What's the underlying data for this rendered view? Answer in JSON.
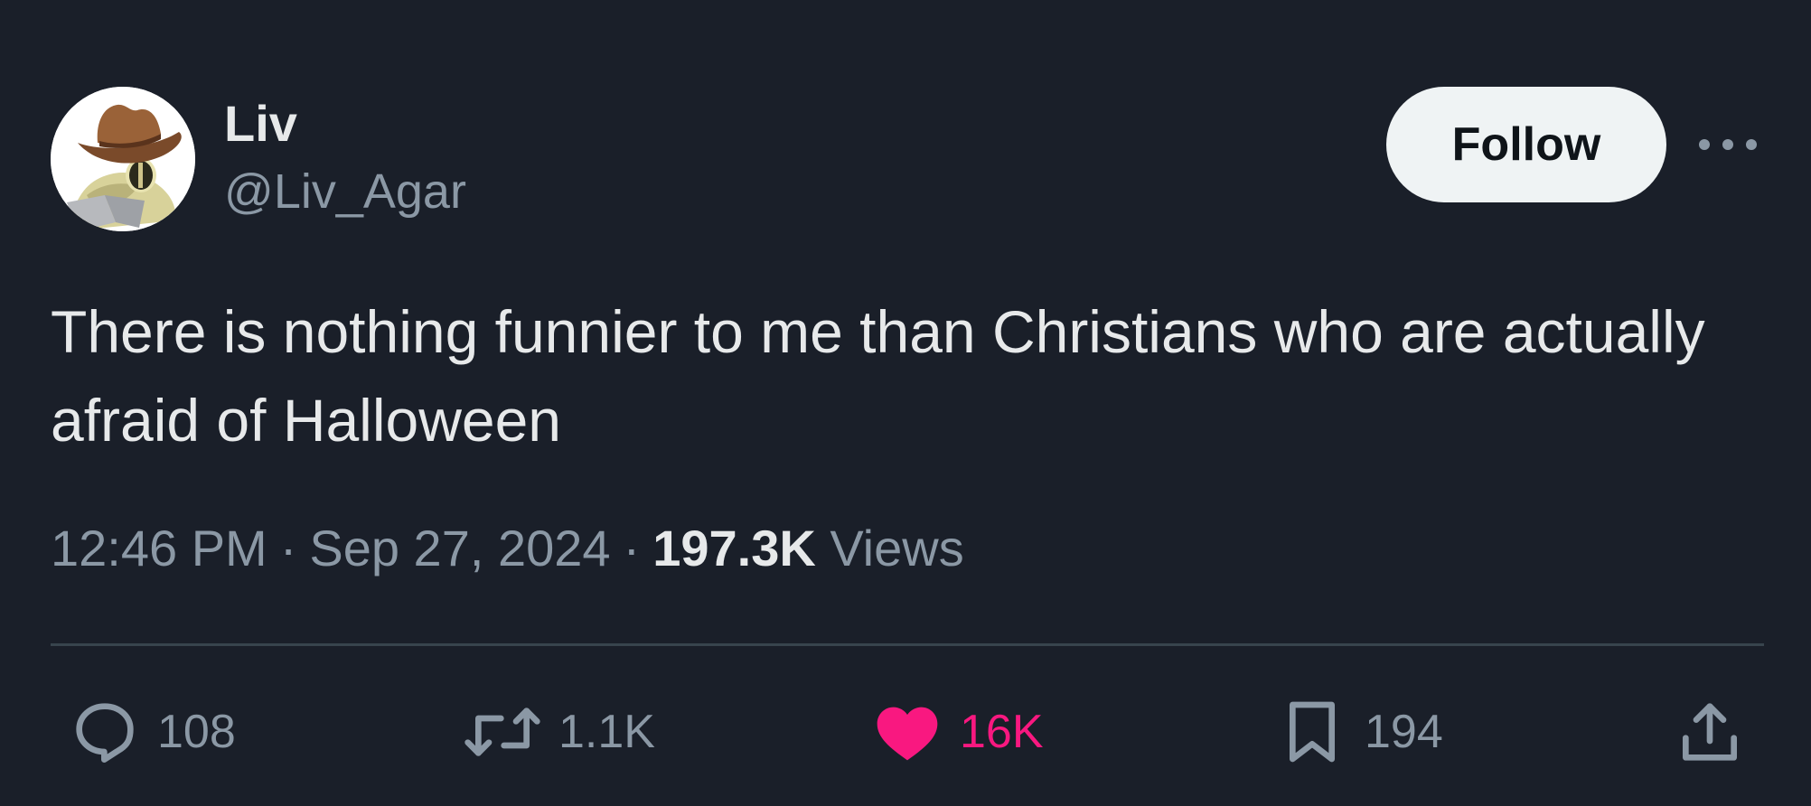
{
  "author": {
    "display_name": "Liv",
    "handle": "@Liv_Agar",
    "avatar_icon": "cowboy-hat-gecko-avatar"
  },
  "header": {
    "follow_label": "Follow",
    "more_icon": "more-horizontal-icon"
  },
  "tweet": {
    "text": "There is nothing funnier to me than Christians who are actually afraid of Halloween"
  },
  "meta": {
    "time": "12:46 PM",
    "separator": "·",
    "date": "Sep 27, 2024",
    "views_count": "197.3K",
    "views_label": "Views"
  },
  "actions": {
    "reply": {
      "icon": "reply-icon",
      "count": "108"
    },
    "repost": {
      "icon": "repost-icon",
      "count": "1.1K"
    },
    "like": {
      "icon": "heart-icon",
      "count": "16K",
      "active": true
    },
    "bookmark": {
      "icon": "bookmark-icon",
      "count": "194"
    },
    "share": {
      "icon": "share-icon"
    }
  },
  "colors": {
    "background": "#1a1f29",
    "text_primary": "#e7e9ea",
    "text_secondary": "#8b98a5",
    "follow_bg": "#eff3f4",
    "like_active": "#f91880",
    "divider": "#38444d"
  }
}
